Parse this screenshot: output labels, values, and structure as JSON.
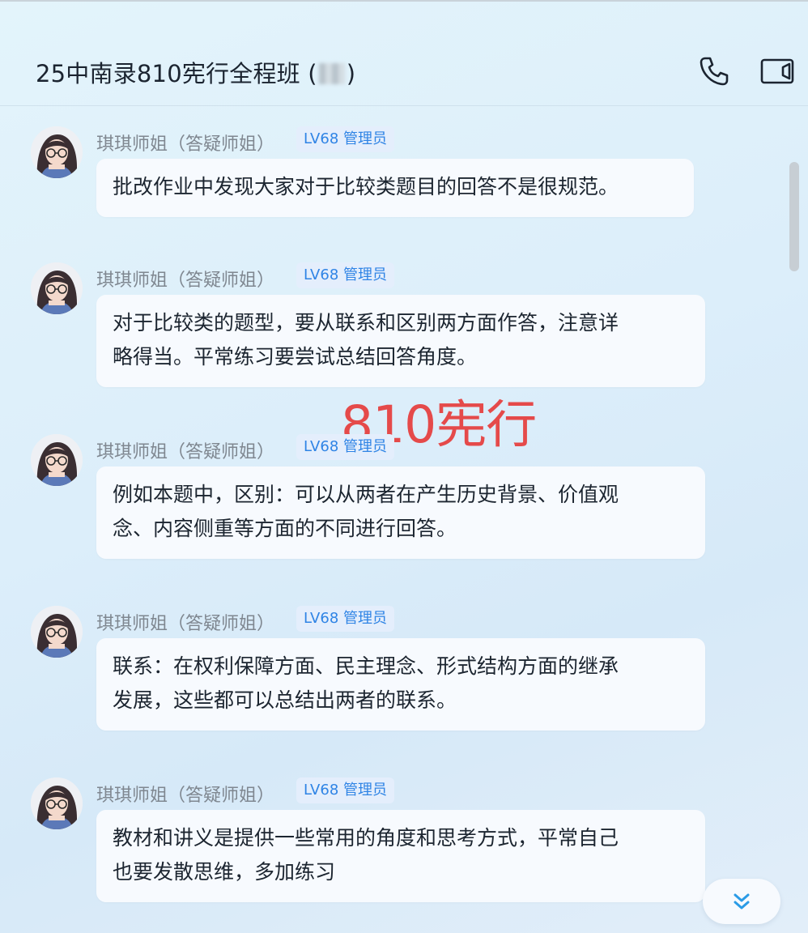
{
  "header": {
    "title": "25中南录810宪行全程班 (",
    "title_suffix": ")",
    "call_icon": "phone-icon",
    "video_icon": "video-camera-icon"
  },
  "messages": [
    {
      "sender": "琪琪师姐（答疑师姐）",
      "badge": "LV68 管理员",
      "lines": [
        "批改作业中发现大家对于比较类题目的回答不是很规范。"
      ]
    },
    {
      "sender": "琪琪师姐（答疑师姐）",
      "badge": "LV68 管理员",
      "lines": [
        "对于比较类的题型，要从联系和区别两方面作答，注意详",
        "略得当。平常练习要尝试总结回答角度。"
      ]
    },
    {
      "sender": "琪琪师姐（答疑师姐）",
      "badge": "LV68 管理员",
      "lines": [
        "例如本题中，区别：可以从两者在产生历史背景、价值观",
        "念、内容侧重等方面的不同进行回答。"
      ]
    },
    {
      "sender": "琪琪师姐（答疑师姐）",
      "badge": "LV68 管理员",
      "lines": [
        "联系：在权利保障方面、民主理念、形式结构方面的继承",
        "发展，这些都可以总结出两者的联系。"
      ]
    },
    {
      "sender": "琪琪师姐（答疑师姐）",
      "badge": "LV68 管理员",
      "lines": [
        "教材和讲义是提供一些常用的角度和思考方式，平常自己",
        "也要发散思维，多加练习"
      ]
    }
  ],
  "watermark": "810宪行",
  "scroll_down_icon": "double-chevron-down-icon",
  "colors": {
    "badge_text": "#2f84e5",
    "badge_bg": "#e4eefc",
    "watermark": "#e54a4a"
  }
}
